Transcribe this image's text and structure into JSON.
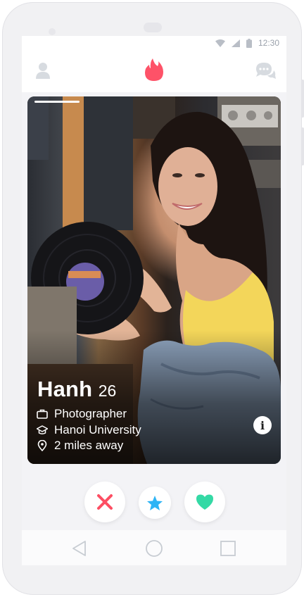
{
  "status_bar": {
    "time": "12:30",
    "icons": [
      "wifi-icon",
      "signal-icon",
      "battery-icon"
    ]
  },
  "app_bar": {
    "left_icon": "profile-icon",
    "center_icon": "flame-logo-icon",
    "right_icon": "messages-icon"
  },
  "profile": {
    "name": "Hanh",
    "age": "26",
    "details": [
      {
        "icon": "briefcase-icon",
        "text": "Photographer"
      },
      {
        "icon": "graduation-cap-icon",
        "text": "Hanoi University"
      },
      {
        "icon": "location-pin-icon",
        "text": "2 miles away"
      }
    ],
    "info_label": "i"
  },
  "actions": [
    {
      "name": "nope",
      "icon": "close-icon"
    },
    {
      "name": "super-like",
      "icon": "star-icon"
    },
    {
      "name": "like",
      "icon": "heart-icon"
    }
  ],
  "colors": {
    "brand": "#fe5268",
    "nope": "#fd4e63",
    "super_like": "#2db4f5",
    "like": "#34d9a5",
    "inactive_icon": "#d7dbe0"
  },
  "system_nav": [
    "back-icon",
    "home-icon",
    "recents-icon"
  ]
}
